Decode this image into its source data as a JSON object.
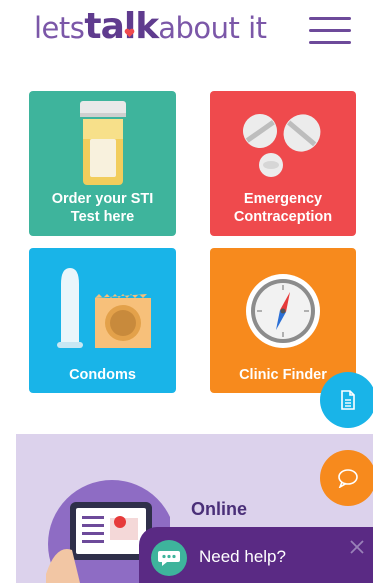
{
  "header": {
    "logo_part1": "lets",
    "logo_part2": "talk",
    "logo_part3": "about it",
    "brand_color": "#6d4a9a",
    "menu_icon": "hamburger-menu-icon"
  },
  "tiles": [
    {
      "label_line1": "Order your STI",
      "label_line2": "Test here",
      "color": "#3eb49c",
      "icon": "pill-bottle-icon"
    },
    {
      "label_line1": "Emergency",
      "label_line2": "Contraception",
      "color": "#ef4a4d",
      "icon": "pills-icon"
    },
    {
      "label_line1": "Condoms",
      "color": "#19b4e8",
      "icon": "condom-icon"
    },
    {
      "label_line1": "Clinic Finder",
      "color": "#f78a1d",
      "icon": "compass-icon"
    }
  ],
  "fabs": {
    "document_icon": "document-icon",
    "chat_icon": "speech-bubble-icon"
  },
  "online": {
    "title": "Online",
    "panel_color": "#dcd2ec"
  },
  "chat_widget": {
    "label": "Need help?",
    "bar_color": "#5a2a84",
    "close_icon": "close-icon"
  }
}
